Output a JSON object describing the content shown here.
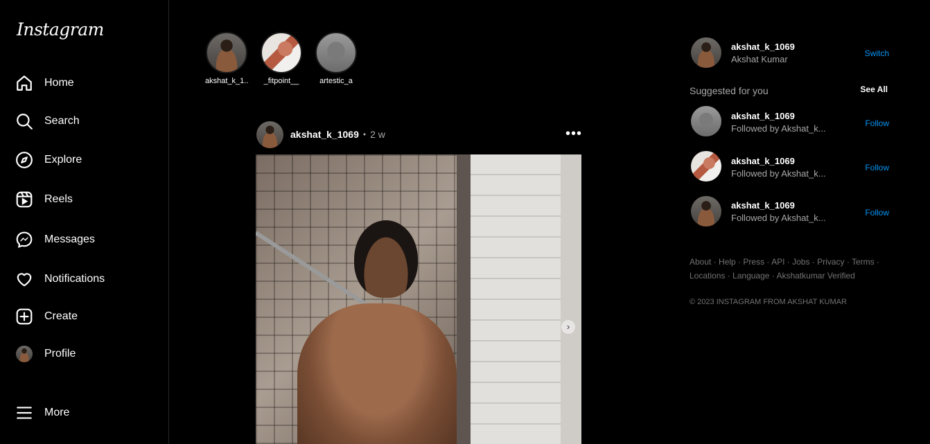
{
  "app": {
    "logo": "Instagram"
  },
  "nav": [
    {
      "label": "Home",
      "icon": "home-icon"
    },
    {
      "label": "Search",
      "icon": "search-icon"
    },
    {
      "label": "Explore",
      "icon": "explore-icon"
    },
    {
      "label": "Reels",
      "icon": "reels-icon"
    },
    {
      "label": "Messages",
      "icon": "messenger-icon"
    },
    {
      "label": "Notifications",
      "icon": "heart-icon"
    },
    {
      "label": "Create",
      "icon": "plus-square-icon"
    },
    {
      "label": "Profile",
      "icon": "avatar"
    },
    {
      "label": "More",
      "icon": "menu-icon"
    }
  ],
  "stories": [
    {
      "name": "akshat_k_1..."
    },
    {
      "name": "_fitpoint__"
    },
    {
      "name": "artestic_a"
    }
  ],
  "post": {
    "username": "akshat_k_1069",
    "separator": "•",
    "time": "2 w",
    "more": "•••"
  },
  "account": {
    "username": "akshat_k_1069",
    "name": "Akshat Kumar",
    "switch_label": "Switch"
  },
  "suggestions": {
    "title": "Suggested for you",
    "see_all": "See All",
    "items": [
      {
        "username": "akshat_k_1069",
        "subtitle": "Followed by Akshat_k...",
        "action": "Follow"
      },
      {
        "username": "akshat_k_1069",
        "subtitle": "Followed by Akshat_k...",
        "action": "Follow"
      },
      {
        "username": "akshat_k_1069",
        "subtitle": "Followed by Akshat_k...",
        "action": "Follow"
      }
    ]
  },
  "footer": {
    "links": [
      "About",
      "Help",
      "Press",
      "API",
      "Jobs",
      "Privacy",
      "Terms",
      "Locations",
      "Language",
      "Akshatkumar Verified"
    ],
    "copyright": "© 2023 INSTAGRAM FROM AKSHAT KUMAR"
  },
  "colors": {
    "background": "#000000",
    "link": "#0095f6",
    "muted": "#a8a8a8",
    "border": "#262626"
  }
}
